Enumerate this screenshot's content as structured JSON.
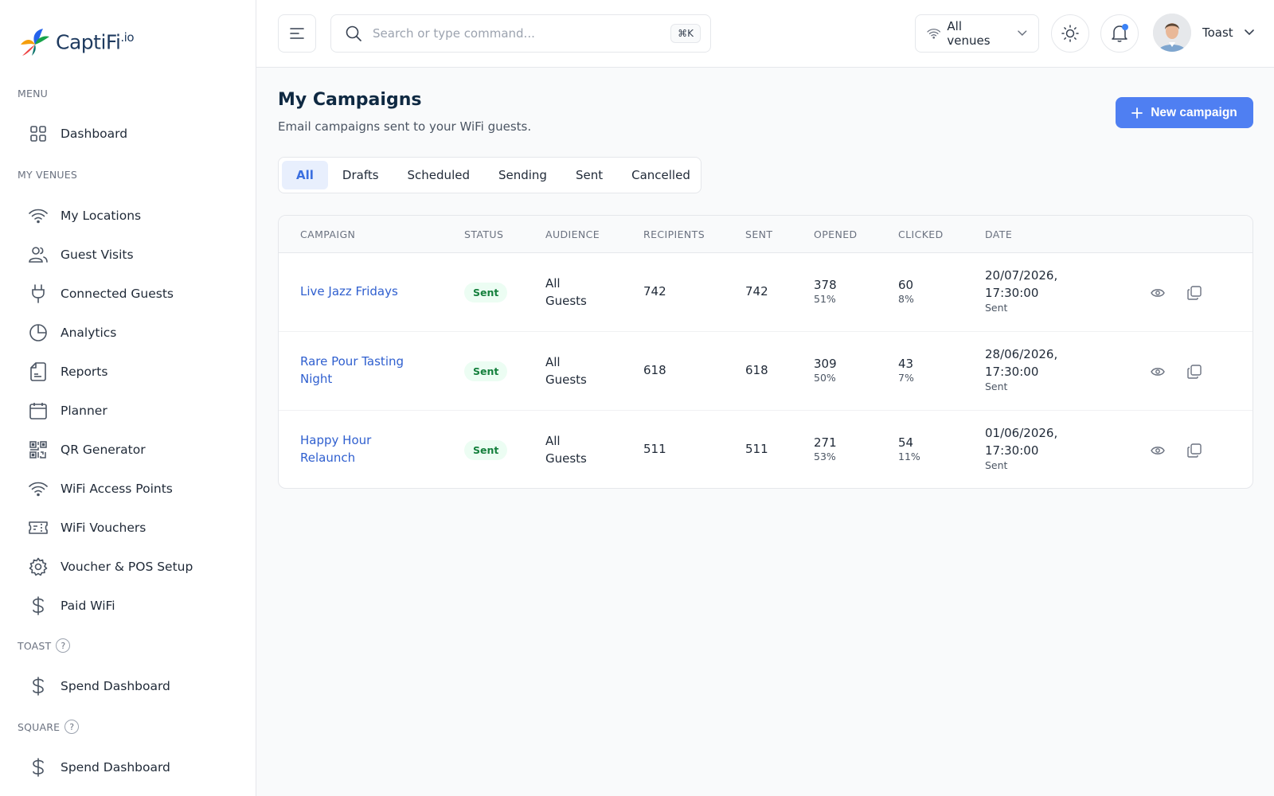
{
  "brand": {
    "name": "CaptiFi",
    "suffix": ".io"
  },
  "sidebar": {
    "menu_label": "MENU",
    "my_venues_label": "MY VENUES",
    "toast_label": "TOAST",
    "square_label": "SQUARE",
    "help_glyph": "?",
    "items": [
      {
        "label": "Dashboard",
        "icon": "grid-icon"
      },
      {
        "label": "My Locations",
        "icon": "wifi-icon"
      },
      {
        "label": "Guest Visits",
        "icon": "users-icon"
      },
      {
        "label": "Connected Guests",
        "icon": "plug-icon"
      },
      {
        "label": "Analytics",
        "icon": "pie-chart-icon"
      },
      {
        "label": "Reports",
        "icon": "document-icon"
      },
      {
        "label": "Planner",
        "icon": "calendar-icon"
      },
      {
        "label": "QR Generator",
        "icon": "qr-code-icon"
      },
      {
        "label": "WiFi Access Points",
        "icon": "wifi-icon"
      },
      {
        "label": "WiFi Vouchers",
        "icon": "ticket-icon"
      },
      {
        "label": "Voucher & POS Setup",
        "icon": "gear-icon"
      },
      {
        "label": "Paid WiFi",
        "icon": "dollar-icon"
      }
    ],
    "toast_items": [
      {
        "label": "Spend Dashboard",
        "icon": "dollar-icon"
      }
    ],
    "square_items": [
      {
        "label": "Spend Dashboard",
        "icon": "dollar-icon"
      }
    ]
  },
  "header": {
    "search_placeholder": "Search or type command...",
    "search_shortcut": "⌘K",
    "venue_select": "All venues",
    "user_name": "Toast"
  },
  "main": {
    "title": "My Campaigns",
    "subtitle": "Email campaigns sent to your WiFi guests.",
    "new_button": "New campaign",
    "tabs": [
      "All",
      "Drafts",
      "Scheduled",
      "Sending",
      "Sent",
      "Cancelled"
    ],
    "active_tab": "All",
    "columns": [
      "CAMPAIGN",
      "STATUS",
      "AUDIENCE",
      "RECIPIENTS",
      "SENT",
      "OPENED",
      "CLICKED",
      "DATE"
    ],
    "rows": [
      {
        "campaign": "Live Jazz Fridays",
        "status": "Sent",
        "audience_1": "All",
        "audience_2": "Guests",
        "recipients": "742",
        "sent": "742",
        "opened": "378",
        "opened_pct": "51%",
        "clicked": "60",
        "clicked_pct": "8%",
        "date_1": "20/07/2026,",
        "date_2": "17:30:00",
        "date_status": "Sent"
      },
      {
        "campaign": "Rare Pour Tasting Night",
        "status": "Sent",
        "audience_1": "All",
        "audience_2": "Guests",
        "recipients": "618",
        "sent": "618",
        "opened": "309",
        "opened_pct": "50%",
        "clicked": "43",
        "clicked_pct": "7%",
        "date_1": "28/06/2026,",
        "date_2": "17:30:00",
        "date_status": "Sent"
      },
      {
        "campaign": "Happy Hour Relaunch",
        "status": "Sent",
        "audience_1": "All",
        "audience_2": "Guests",
        "recipients": "511",
        "sent": "511",
        "opened": "271",
        "opened_pct": "53%",
        "clicked": "54",
        "clicked_pct": "11%",
        "date_1": "01/06/2026,",
        "date_2": "17:30:00",
        "date_status": "Sent"
      }
    ]
  },
  "colors": {
    "accent": "#4f7ff2",
    "link": "#2f5fcf",
    "status_sent_bg": "#ecfdf3",
    "status_sent_text": "#15803d",
    "notification": "#3b82f6"
  }
}
